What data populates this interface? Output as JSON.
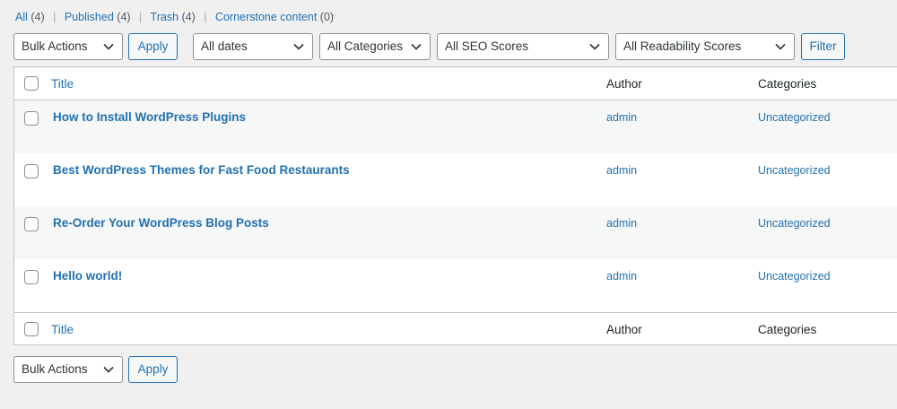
{
  "filters": [
    {
      "label": "All",
      "count": "(4)"
    },
    {
      "label": "Published",
      "count": "(4)"
    },
    {
      "label": "Trash",
      "count": "(4)"
    },
    {
      "label": "Cornerstone content",
      "count": "(0)"
    }
  ],
  "toolbar": {
    "bulk_actions": "Bulk Actions",
    "apply": "Apply",
    "dates": "All dates",
    "categories": "All Categories",
    "seo": "All SEO Scores",
    "readability": "All Readability Scores",
    "filter": "Filter"
  },
  "columns": {
    "title": "Title",
    "author": "Author",
    "categories": "Categories"
  },
  "posts": [
    {
      "title": "How to Install WordPress Plugins",
      "author": "admin",
      "category": "Uncategorized"
    },
    {
      "title": "Best WordPress Themes for Fast Food Restaurants",
      "author": "admin",
      "category": "Uncategorized"
    },
    {
      "title": "Re-Order Your WordPress Blog Posts",
      "author": "admin",
      "category": "Uncategorized"
    },
    {
      "title": "Hello world!",
      "author": "admin",
      "category": "Uncategorized"
    }
  ],
  "bottom_toolbar": {
    "bulk_actions": "Bulk Actions",
    "apply": "Apply"
  },
  "icons": {
    "dropdown": "chevron-down-icon"
  }
}
